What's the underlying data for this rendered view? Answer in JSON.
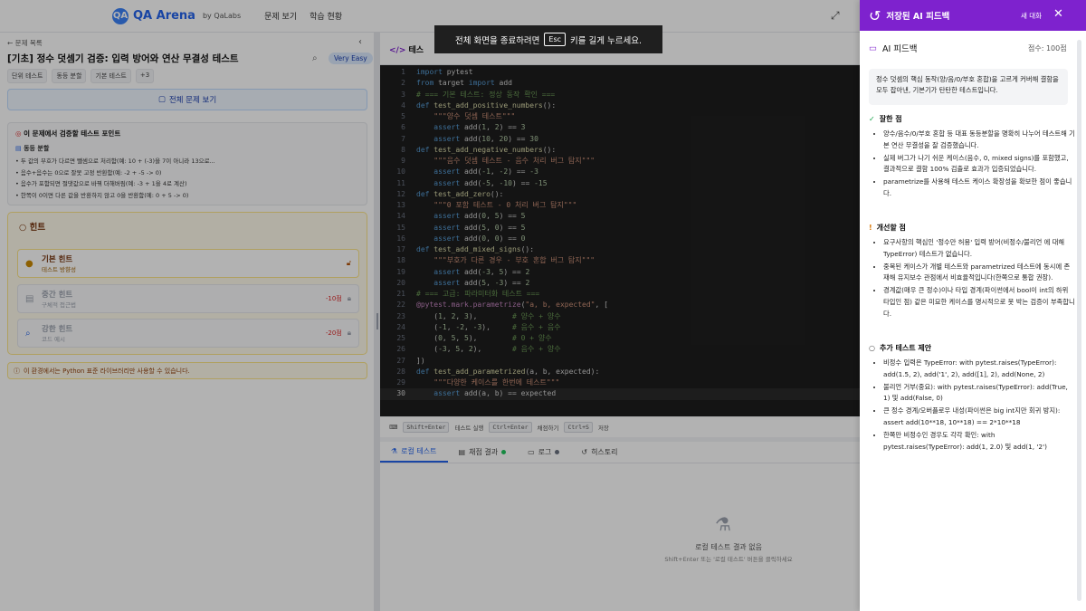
{
  "nav": {
    "logo_mark": "QA",
    "brand": "QA Arena",
    "by": "by QaLabs",
    "links": [
      "문제 보기",
      "학습 현황"
    ]
  },
  "toast": {
    "before": "전체 화면을 종료하려면",
    "key": "Esc",
    "after": "키를 길게 누르세요."
  },
  "problem": {
    "back": "← 문제 목록",
    "title": "[기초] 정수 덧셈기 검증: 입력 방어와 연산 무결성 테스트",
    "difficulty": "Very Easy",
    "tags": [
      "단위 테스트",
      "동등 분할",
      "기본 테스트",
      "+3"
    ],
    "view_all": "전체 문제 보기",
    "points_title": "이 문제에서 검증할 테스트 포인트",
    "points_sub": "동등 분할",
    "points": [
      "• 두 값의 부호가 다르면 뺄셈으로 처리함(예: 10 + (-3)을 7이 아니라 13으로...",
      "• 음수+음수는 0으로 잘못 고정 반환함(예: -2 + -5 -> 0)",
      "• 음수가 포함되면 절댓값으로 바꿔 더해버림(예: -3 + 1을 4로 계산)",
      "• 한쪽이 0이면 다른 값을 반환하지 않고 0을 반환함(예: 0 + 5 -> 0)"
    ],
    "hints_title": "힌트",
    "hints": [
      {
        "name": "기본 힌트",
        "desc": "테스트 방향성",
        "cost": ""
      },
      {
        "name": "중간 힌트",
        "desc": "구체적 접근법",
        "cost": "-10점"
      },
      {
        "name": "강한 힌트",
        "desc": "코드 예시",
        "cost": "-20점"
      }
    ],
    "notice": "이 환경에서는 Python 표준 라이브러리만 사용할 수 있습니다."
  },
  "editor": {
    "title": "테스",
    "code": [
      "import pytest",
      "from target import add",
      "# === 기본 테스트: 정상 동작 확인 ===",
      "def test_add_positive_numbers():",
      "    \"\"\"양수 덧셈 테스트\"\"\"",
      "    assert add(1, 2) == 3",
      "    assert add(10, 20) == 30",
      "def test_add_negative_numbers():",
      "    \"\"\"음수 덧셈 테스트 - 음수 처리 버그 탐지\"\"\"",
      "    assert add(-1, -2) == -3",
      "    assert add(-5, -10) == -15",
      "def test_add_zero():",
      "    \"\"\"0 포함 테스트 - 0 처리 버그 탐지\"\"\"",
      "    assert add(0, 5) == 5",
      "    assert add(5, 0) == 5",
      "    assert add(0, 0) == 0",
      "def test_add_mixed_signs():",
      "    \"\"\"부호가 다른 경우 - 부호 혼합 버그 탐지\"\"\"",
      "    assert add(-3, 5) == 2",
      "    assert add(5, -3) == 2",
      "# === 고급: 파라미터화 테스트 ===",
      "@pytest.mark.parametrize(\"a, b, expected\", [",
      "    (1, 2, 3),        # 양수 + 양수",
      "    (-1, -2, -3),     # 음수 + 음수",
      "    (0, 5, 5),        # 0 + 양수",
      "    (-3, 5, 2),       # 음수 + 양수",
      "])",
      "def test_add_parametrized(a, b, expected):",
      "    \"\"\"다양한 케이스를 한번에 테스트\"\"\"",
      "    assert add(a, b) == expected"
    ],
    "current_line": 30,
    "shortcuts": [
      {
        "key": "Shift+Enter",
        "label": "테스트 실행"
      },
      {
        "key": "Ctrl+Enter",
        "label": "채점하기"
      },
      {
        "key": "Ctrl+S",
        "label": "저장"
      }
    ]
  },
  "bottom": {
    "tabs": [
      "로컬 테스트",
      "채점 결과",
      "로그",
      "히스토리"
    ],
    "empty_title": "로컬 테스트 결과 없음",
    "empty_sub": "Shift+Enter 또는 '로컬 테스트' 버튼을 클릭하세요"
  },
  "feedback": {
    "header": "저장된 AI 피드백",
    "new_chat": "새 대화",
    "title": "AI 피드백",
    "score": "점수: 100점",
    "summary": "정수 덧셈의 핵심 동작(양/음/0/부호 혼합)을 고르게 커버해 결함을 모두 잡아낸, 기본기가 탄탄한 테스트입니다.",
    "good_title": "잘한 점",
    "good": [
      "양수/음수/0/부호 혼합 등 대표 동등분할을 명확히 나누어 테스트해 기본 연산 무결성을 잘 검증했습니다.",
      "실제 버그가 나기 쉬운 케이스(음수, 0, mixed signs)를 포함했고, 결과적으로 결함 100% 검출로 효과가 입증되었습니다.",
      "parametrize를 사용해 테스트 케이스 확장성을 확보한 점이 좋습니다."
    ],
    "improve_title": "개선할 점",
    "improve": [
      "요구사항의 핵심인 '정수만 허용' 입력 방어(비정수/불리언 에 대해 TypeError) 테스트가 없습니다.",
      "중복된 케이스가 개별 테스트와 parametrized 테스트에 동시에 존재해 유지보수 관점에서 비효율적입니다(한쪽으로 통합 권장).",
      "경계값(매우 큰 정수)이나 타입 경계(파이썬에서 bool이 int의 하위 타입인 점) 같은 미묘한 케이스를 명시적으로 못 박는 검증이 부족합니다."
    ],
    "extra_title": "추가 테스트 제안",
    "extra": [
      "비정수 입력은 TypeError: with pytest.raises(TypeError): add(1.5, 2), add('1', 2), add([1], 2), add(None, 2)",
      "불리언 거부(중요): with pytest.raises(TypeError): add(True, 1) 및 add(False, 0)",
      "큰 정수 경계/오버플로우 내성(파이썬은 big int지만 회귀 방지): assert add(10**18, 10**18) == 2*10**18",
      "한쪽만 비정수인 경우도 각각 확인: with pytest.raises(TypeError): add(1, 2.0) 및 add(1, '2')"
    ]
  },
  "colors": {
    "accent": "#7e22ce",
    "brand": "#2563eb"
  }
}
